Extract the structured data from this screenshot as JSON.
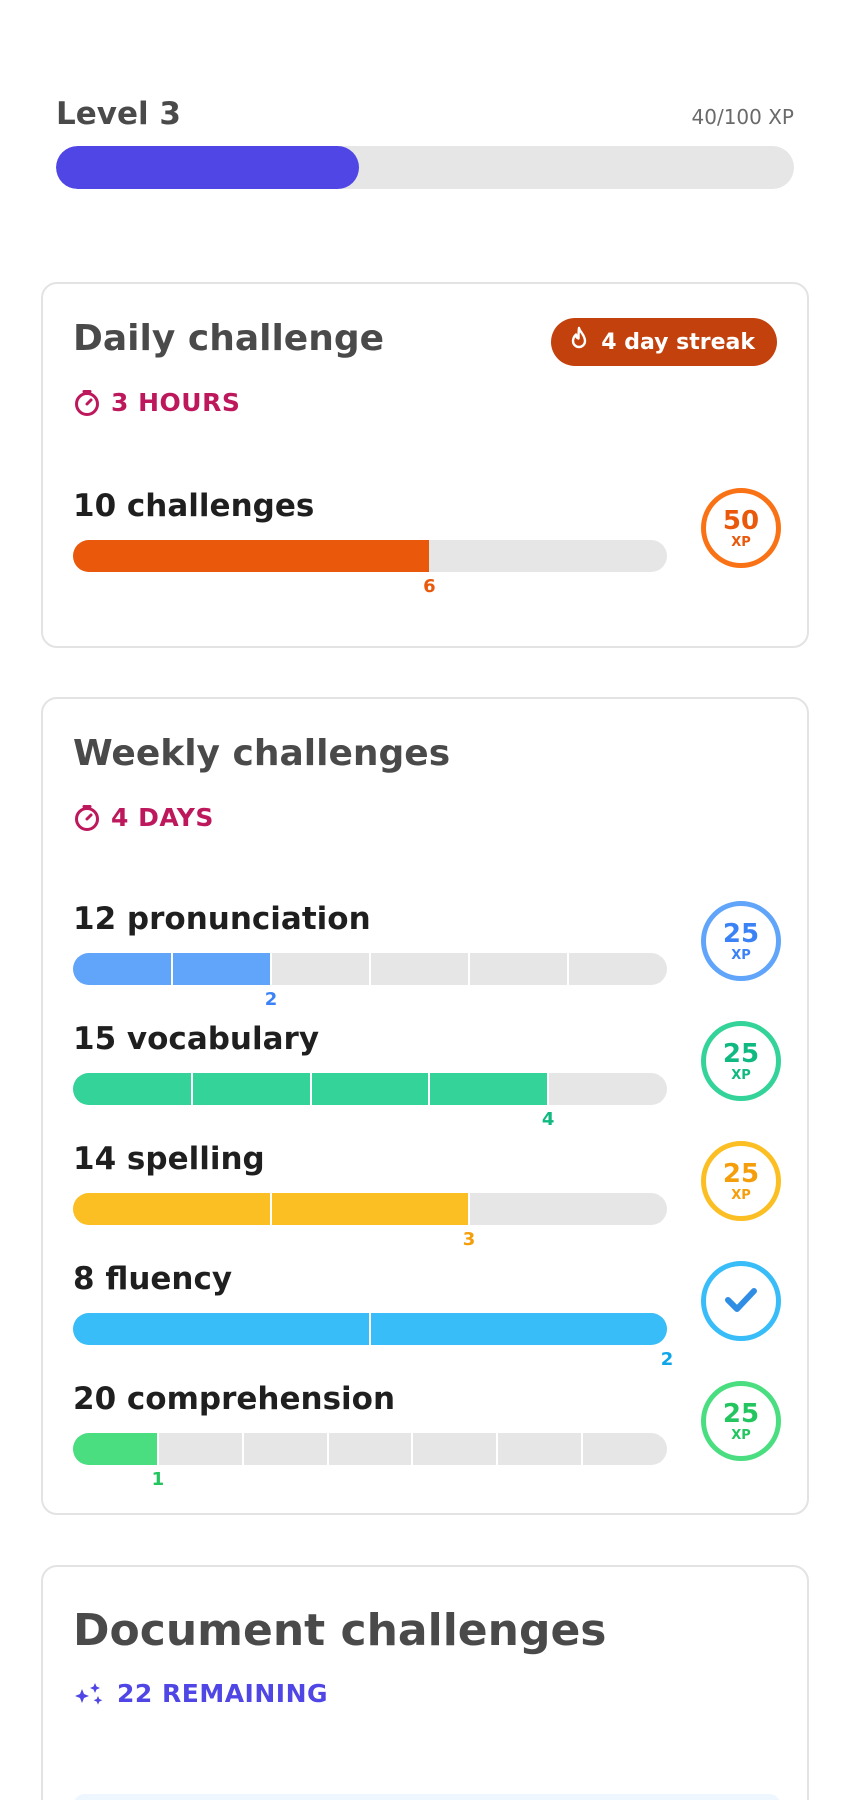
{
  "level": {
    "title": "Level 3",
    "xp_text": "40/100 XP",
    "progress": 0.41,
    "color": "#4f46e5"
  },
  "daily": {
    "title": "Daily challenge",
    "timer": "3 HOURS",
    "streak": "4 day streak",
    "streak_color": "#c2410c",
    "challenge": {
      "label": "10 challenges",
      "total": 10,
      "done": 6,
      "done_label": "6",
      "reward": "50",
      "reward_unit": "XP",
      "color": "#ea580c",
      "ring": "#f97316"
    }
  },
  "weekly": {
    "title": "Weekly challenges",
    "timer": "4 DAYS",
    "challenges": [
      {
        "label": "12 pronunciation",
        "segments": 6,
        "done": 2,
        "done_label": "2",
        "reward": "25",
        "reward_unit": "XP",
        "color": "#60a5fa",
        "text_color": "#3b82f6",
        "completed": false
      },
      {
        "label": "15 vocabulary",
        "segments": 5,
        "done": 4,
        "done_label": "4",
        "reward": "25",
        "reward_unit": "XP",
        "color": "#34d399",
        "text_color": "#10b981",
        "completed": false
      },
      {
        "label": "14 spelling",
        "segments": 3,
        "done": 2,
        "done_label": "3",
        "reward": "25",
        "reward_unit": "XP",
        "color": "#fbbf24",
        "text_color": "#f59e0b",
        "completed": false
      },
      {
        "label": "8 fluency",
        "segments": 2,
        "done": 2,
        "done_label": "2",
        "reward": "",
        "reward_unit": "",
        "color": "#38bdf8",
        "text_color": "#0ea5e9",
        "completed": true
      },
      {
        "label": "20 comprehension",
        "segments": 7,
        "done": 1,
        "done_label": "1",
        "reward": "25",
        "reward_unit": "XP",
        "color": "#4ade80",
        "text_color": "#22c55e",
        "completed": false
      }
    ]
  },
  "document": {
    "title": "Document challenges",
    "remaining": "22 REMAINING"
  },
  "icons": {
    "timer": "stopwatch-icon",
    "streak": "flame-icon",
    "remaining": "sparkles-icon",
    "completed": "checkmark-icon"
  }
}
